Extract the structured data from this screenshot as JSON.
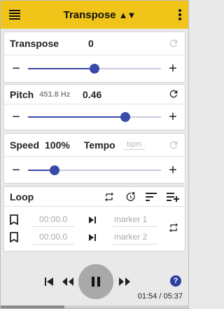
{
  "appbar": {
    "title": "Transpose",
    "title_arrows": "▲▼",
    "menu_icon": "hamburger-icon",
    "more_icon": "kebab-icon"
  },
  "transpose": {
    "label": "Transpose",
    "value": "0",
    "slider_fraction": 0.5,
    "reset_enabled": false
  },
  "pitch": {
    "label": "Pitch",
    "frequency": "451.8 Hz",
    "value": "0.46",
    "slider_fraction": 0.73,
    "reset_enabled": true
  },
  "speed": {
    "label": "Speed",
    "value": "100%",
    "tempo_label": "Tempo",
    "tempo_placeholder": "bpm",
    "slider_fraction": 0.2,
    "reset_enabled": false
  },
  "loop": {
    "label": "Loop",
    "markers": [
      {
        "time": "00:00.0",
        "name": "marker 1"
      },
      {
        "time": "00:00.0",
        "name": "marker 2"
      }
    ]
  },
  "player": {
    "time": "01:54 / 05:37",
    "progress_fraction": 0.34,
    "state": "playing"
  },
  "colors": {
    "accent": "#f0c419",
    "slider": "#3a4aa8"
  }
}
